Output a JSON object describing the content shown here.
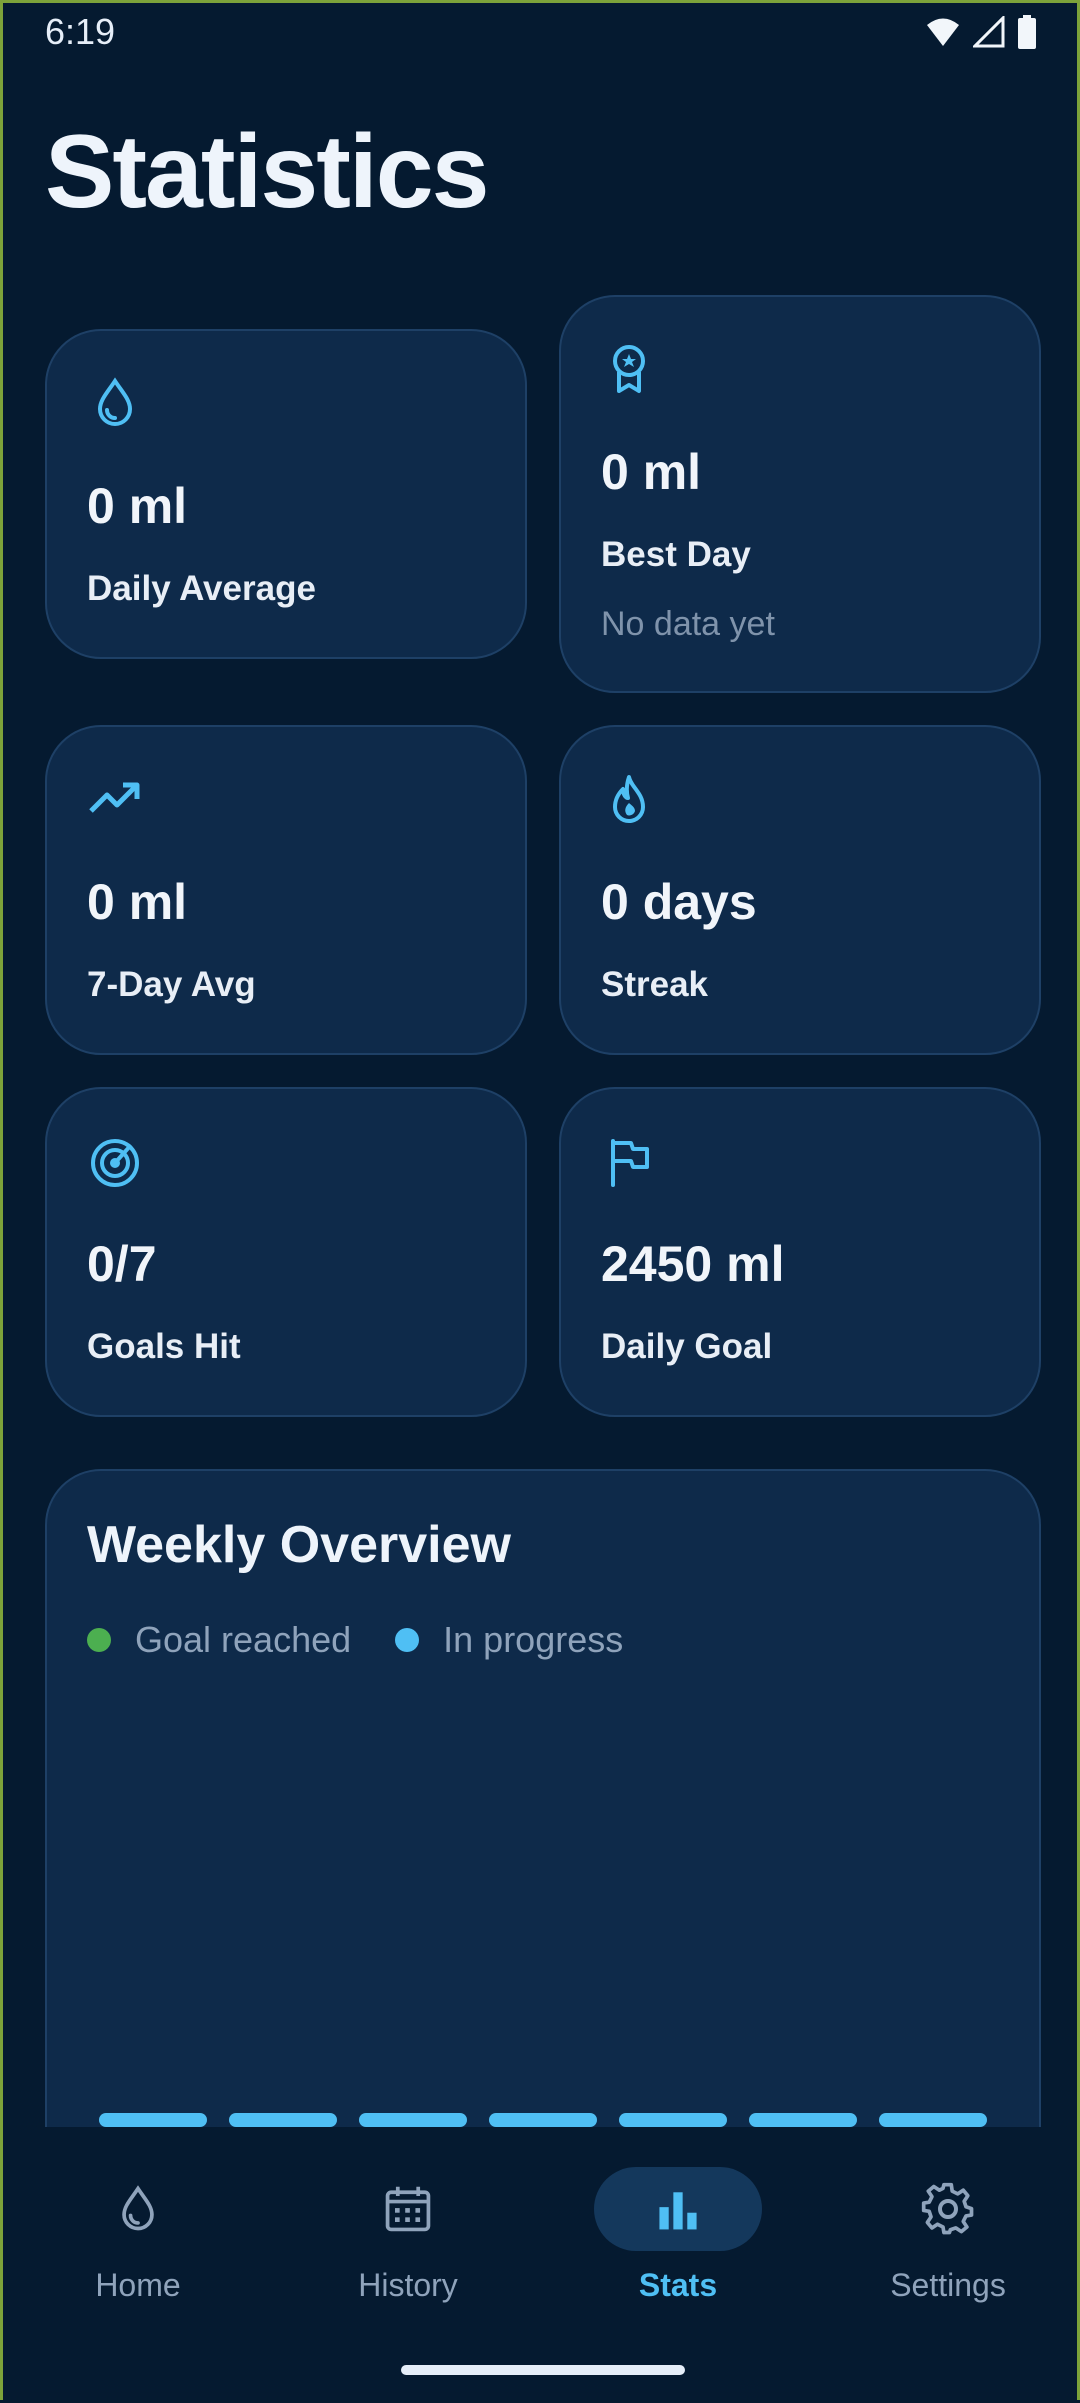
{
  "status_bar": {
    "time": "6:19"
  },
  "page_title": "Statistics",
  "cards": {
    "daily_average": {
      "value": "0 ml",
      "label": "Daily Average",
      "icon": "water-drop-icon"
    },
    "best_day": {
      "value": "0 ml",
      "label": "Best Day",
      "sub": "No data yet",
      "icon": "award-badge-icon"
    },
    "seven_day_avg": {
      "value": "0 ml",
      "label": "7-Day Avg",
      "icon": "trending-up-icon"
    },
    "streak": {
      "value": "0 days",
      "label": "Streak",
      "icon": "flame-icon"
    },
    "goals_hit": {
      "value": "0/7",
      "label": "Goals Hit",
      "icon": "target-icon"
    },
    "daily_goal": {
      "value": "2450 ml",
      "label": "Daily Goal",
      "icon": "flag-icon"
    }
  },
  "weekly": {
    "title": "Weekly Overview",
    "legend": [
      {
        "label": "Goal reached",
        "color": "#4caf50"
      },
      {
        "label": "In progress",
        "color": "#4fbff4"
      }
    ]
  },
  "chart_data": {
    "type": "bar",
    "values": [
      0,
      0,
      0,
      0,
      0,
      0,
      0
    ],
    "series": [
      {
        "name": "In progress",
        "values": [
          0,
          0,
          0,
          0,
          0,
          0,
          0
        ]
      }
    ]
  },
  "nav": {
    "items": [
      {
        "label": "Home",
        "icon": "water-drop-icon",
        "active": false
      },
      {
        "label": "History",
        "icon": "calendar-icon",
        "active": false
      },
      {
        "label": "Stats",
        "icon": "bar-chart-icon",
        "active": true
      },
      {
        "label": "Settings",
        "icon": "gear-icon",
        "active": false
      }
    ]
  },
  "colors": {
    "background": "#051a30",
    "card": "#0e2a4a",
    "accent": "#4fbff4",
    "goal_reached": "#4caf50"
  }
}
